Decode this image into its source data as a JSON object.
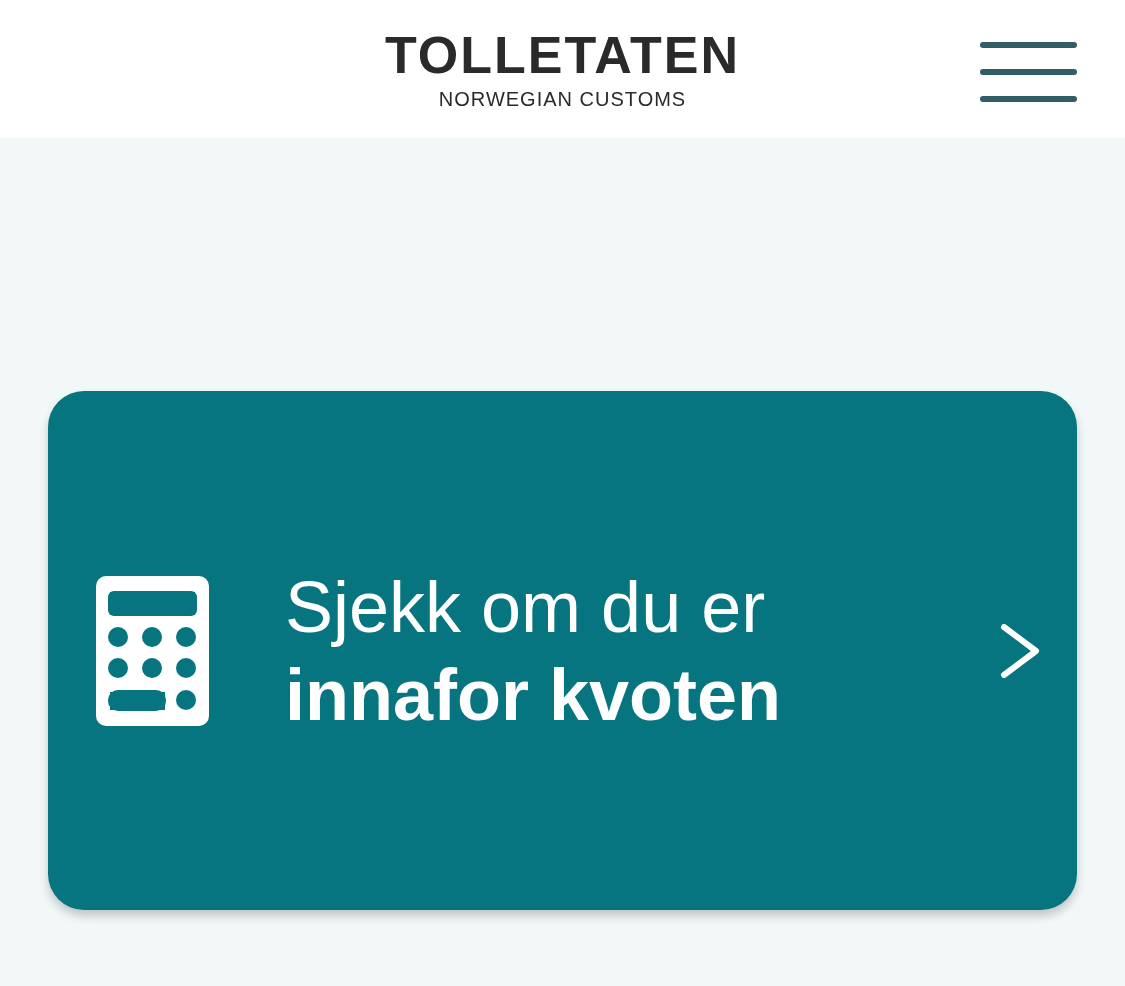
{
  "header": {
    "logo_title": "TOLLETATEN",
    "logo_subtitle": "NORWEGIAN CUSTOMS"
  },
  "card": {
    "text": "Sjekk om du er **innafor kvoten**"
  }
}
